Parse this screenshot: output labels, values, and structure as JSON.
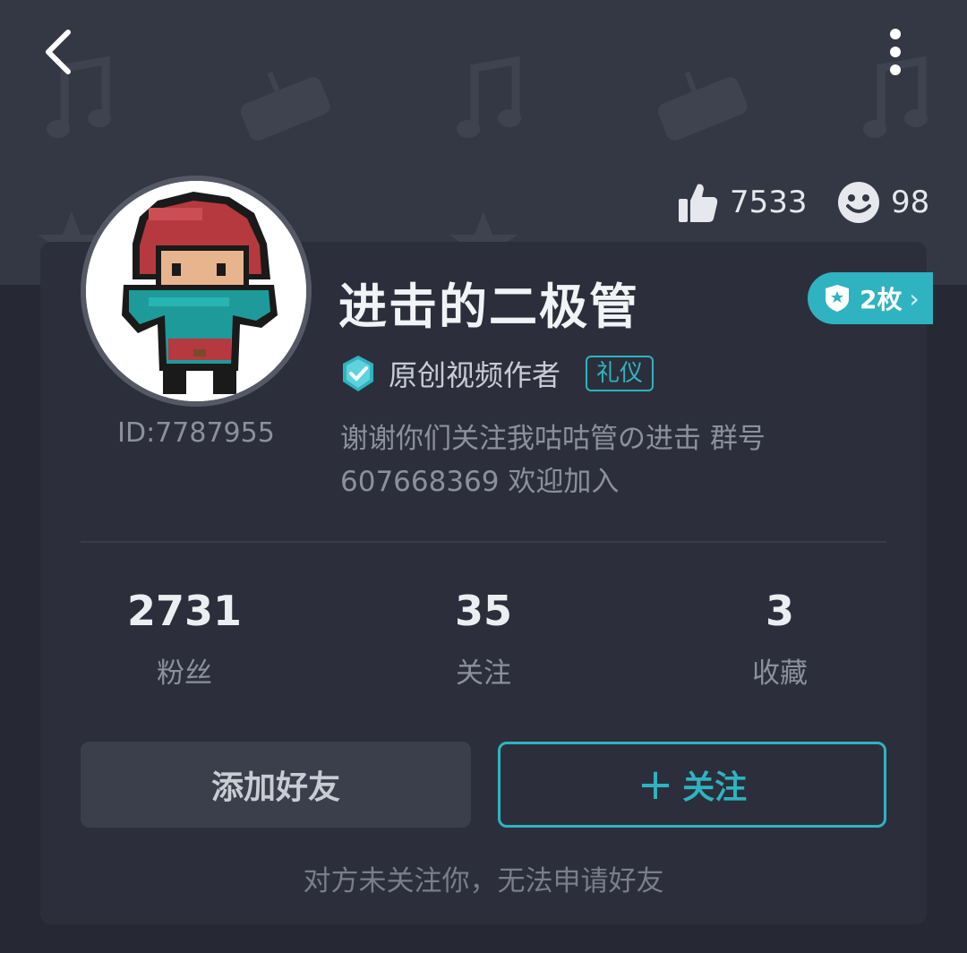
{
  "header": {
    "back_icon": "chevron-left-icon",
    "more_icon": "more-vertical-icon",
    "likes": "7533",
    "fans_icon_count": "98"
  },
  "profile": {
    "username": "进击的二极管",
    "user_id": "ID:7787955",
    "verified_label": "原创视频作者",
    "tag": "礼仪",
    "badge_count": "2枚",
    "bio": "谢谢你们关注我咕咕管の进击 群号 607668369 欢迎加入"
  },
  "stats": [
    {
      "value": "2731",
      "label": "粉丝"
    },
    {
      "value": "35",
      "label": "关注"
    },
    {
      "value": "3",
      "label": "收藏"
    }
  ],
  "actions": {
    "add_friend": "添加好友",
    "follow_plus": "+",
    "follow": "关注",
    "notice": "对方未关注你，无法申请好友"
  },
  "colors": {
    "accent": "#2fb3c1",
    "background": "#262833",
    "card": "#2c2f3b"
  }
}
